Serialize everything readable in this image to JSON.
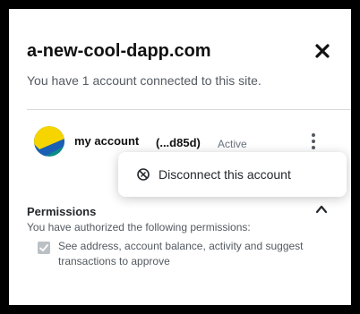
{
  "header": {
    "site_title": "a-new-cool-dapp.com",
    "connected_text": "You have 1 account connected to this site.",
    "close_glyph": "✕"
  },
  "account": {
    "name": "my account",
    "address": "(...d85d)",
    "status": "Active"
  },
  "menu": {
    "disconnect_label": "Disconnect this account",
    "icon": "disconnect-icon"
  },
  "permissions": {
    "title": "Permissions",
    "description": "You have authorized the following permissions:",
    "item": "See address, account balance, activity and suggest transactions to approve",
    "item_checked": true
  },
  "colors": {
    "avatar_yellow": "#f5d400",
    "avatar_blue": "#1a5fb4",
    "avatar_teal": "#0b8a8a"
  }
}
